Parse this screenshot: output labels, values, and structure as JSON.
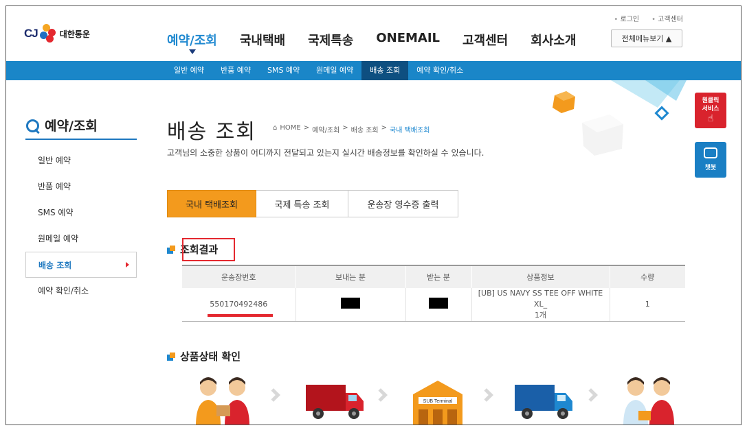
{
  "brand": {
    "logo_text": "CJ",
    "logo_kr": "대한통운"
  },
  "util_links": [
    "로그인",
    "고객센터"
  ],
  "gnb": [
    "예약/조회",
    "국내택배",
    "국제특송",
    "ONEMAIL",
    "고객센터",
    "회사소개"
  ],
  "all_menu_label": "전체메뉴보기 ▲",
  "subnav": [
    "일반 예약",
    "반품 예약",
    "SMS 예약",
    "원메일 예약",
    "배송 조회",
    "예약 확인/취소"
  ],
  "sidebar": {
    "title": "예약/조회",
    "items": [
      "일반 예약",
      "반품 예약",
      "SMS 예약",
      "원메일 예약",
      "배송 조회",
      "예약 확인/취소"
    ]
  },
  "page": {
    "title": "배송 조회",
    "breadcrumb": [
      "HOME",
      "예약/조회",
      "배송 조회",
      "국내 택배조회"
    ],
    "description": "고객님의 소중한 상품이 어디까지 전달되고 있는지 실시간 배송정보를 확인하실 수 있습니다."
  },
  "tabs": [
    "국내 택배조회",
    "국제 특송 조회",
    "운송장 영수증 출력"
  ],
  "result": {
    "heading": "조회결과",
    "columns": [
      "운송장번호",
      "보내는 분",
      "받는 분",
      "상품정보",
      "수량"
    ],
    "row": {
      "tracking_no": "550170492486",
      "product_line1": "[UB] US NAVY SS TEE OFF WHITE XL_",
      "product_line2": "1개",
      "qty": "1"
    }
  },
  "status": {
    "heading": "상품상태 확인",
    "terminal_label": "SUB Terminal"
  },
  "floating": {
    "oneclick": [
      "원클릭",
      "서비스"
    ],
    "chatbot": "챗봇"
  },
  "colors": {
    "primary_blue": "#1a86c8",
    "accent_orange": "#f39a1d",
    "highlight_red": "#e4282f"
  }
}
